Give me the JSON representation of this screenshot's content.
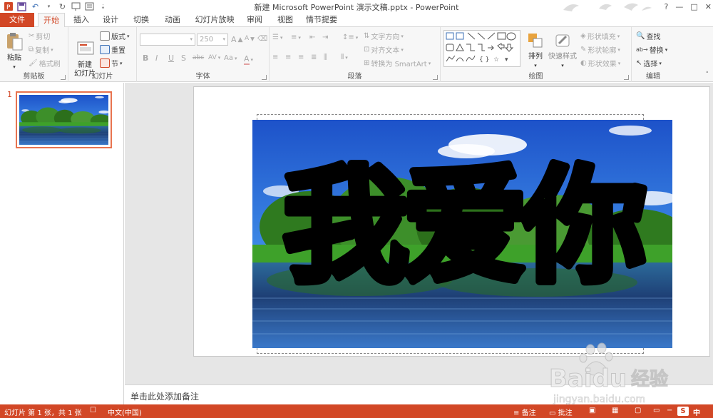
{
  "window": {
    "title": "新建 Microsoft PowerPoint 演示文稿.pptx - PowerPoint",
    "controls": [
      "?",
      "—",
      "□",
      "✕"
    ]
  },
  "tabs": [
    {
      "label": "文件"
    },
    {
      "label": "开始"
    },
    {
      "label": "插入"
    },
    {
      "label": "设计"
    },
    {
      "label": "切换"
    },
    {
      "label": "动画"
    },
    {
      "label": "幻灯片放映"
    },
    {
      "label": "审阅"
    },
    {
      "label": "视图"
    },
    {
      "label": "情节提要"
    }
  ],
  "ribbon": {
    "clipboard": {
      "label": "剪贴板",
      "paste": "粘贴",
      "cut": "剪切",
      "copy": "复制",
      "format_painter": "格式刷"
    },
    "slides": {
      "label": "幻灯片",
      "new_slide": "新建\n幻灯片",
      "layout": "版式",
      "reset": "重置",
      "section": "节"
    },
    "font": {
      "label": "字体",
      "font_name": "",
      "font_size": "250",
      "bold": "B",
      "italic": "I",
      "underline": "U",
      "shadow": "S",
      "strike": "abc",
      "spacing": "AV",
      "case": "Aa",
      "grow": "A",
      "shrink": "A"
    },
    "paragraph": {
      "label": "段落",
      "text_direction": "文字方向",
      "align_text": "对齐文本",
      "smartart": "转换为 SmartArt"
    },
    "drawing": {
      "label": "绘图",
      "arrange": "排列",
      "quick_styles": "快速样式",
      "shape_fill": "形状填充",
      "shape_outline": "形状轮廓",
      "shape_effects": "形状效果"
    },
    "editing": {
      "label": "编辑",
      "find": "查找",
      "replace": "替换",
      "select": "选择"
    }
  },
  "slides_pane": {
    "slide_number": "1"
  },
  "slide": {
    "art_text": "我爱你"
  },
  "notes": {
    "placeholder": "单击此处添加备注"
  },
  "status": {
    "slide_info": "幻灯片 第 1 张，共 1 张",
    "language": "中文(中国)",
    "notes_btn": "备注",
    "comments_btn": "批注",
    "ime": "中"
  },
  "watermark": {
    "brand": "Baidu",
    "brand_cn": "经验",
    "url": "jingyan.baidu.com"
  },
  "colors": {
    "accent": "#d24726",
    "ribbon_bg": "#f7f7f7"
  }
}
